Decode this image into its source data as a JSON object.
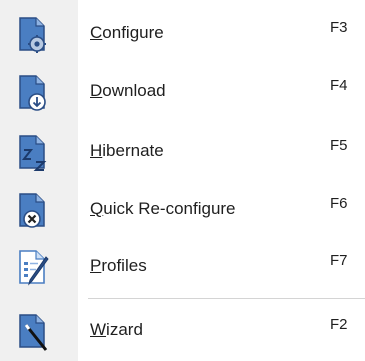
{
  "menu": {
    "items": [
      {
        "id": "configure",
        "mnemonic": "C",
        "rest": "onfigure",
        "shortcut": "F3",
        "icon": "doc-gear-icon"
      },
      {
        "id": "download",
        "mnemonic": "D",
        "rest": "ownload",
        "shortcut": "F4",
        "icon": "doc-download-icon"
      },
      {
        "id": "hibernate",
        "mnemonic": "H",
        "rest": "ibernate",
        "shortcut": "F5",
        "icon": "doc-sleep-icon"
      },
      {
        "id": "quick-reconfigure",
        "mnemonic": "Q",
        "rest": "uick Re-configure",
        "shortcut": "F6",
        "icon": "doc-cancel-icon"
      },
      {
        "id": "profiles",
        "mnemonic": "P",
        "rest": "rofiles",
        "shortcut": "F7",
        "icon": "doc-pen-icon"
      },
      {
        "id": "wizard",
        "mnemonic": "W",
        "rest": "izard",
        "shortcut": "F2",
        "icon": "doc-wand-icon"
      }
    ]
  },
  "colors": {
    "icon_blue": "#4a7ec2",
    "icon_dark": "#2a4d85",
    "gutter": "#f0f0f0",
    "separator": "#d4d4d4"
  }
}
